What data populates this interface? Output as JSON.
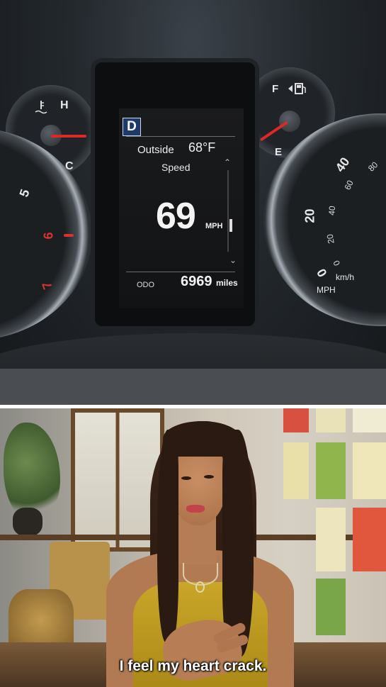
{
  "dashboard": {
    "gear": "D",
    "outside_label": "Outside",
    "outside_temp": "68°F",
    "speed_label": "Speed",
    "speed_value": "69",
    "speed_unit": "MPH",
    "odo_label": "ODO",
    "odo_value": "6969",
    "odo_unit": "miles",
    "temp_gauge": {
      "high": "H",
      "low": "C"
    },
    "fuel_gauge": {
      "full": "F",
      "empty": "E"
    },
    "tach_numbers": [
      "5",
      "6",
      "7"
    ],
    "speedometer": {
      "mph_numbers": [
        "0",
        "20",
        "40"
      ],
      "kmh_numbers": [
        "0",
        "20",
        "40",
        "60",
        "80"
      ],
      "kmh_label": "km/h",
      "mph_label": "MPH"
    },
    "colors": {
      "needle": "#e02727",
      "redline": "#d83232",
      "gear_box": "#1d3a6a"
    },
    "icons": [
      "coolant-temp-icon",
      "fuel-pump-icon"
    ]
  },
  "scene": {
    "caption": "I feel my heart crack."
  }
}
